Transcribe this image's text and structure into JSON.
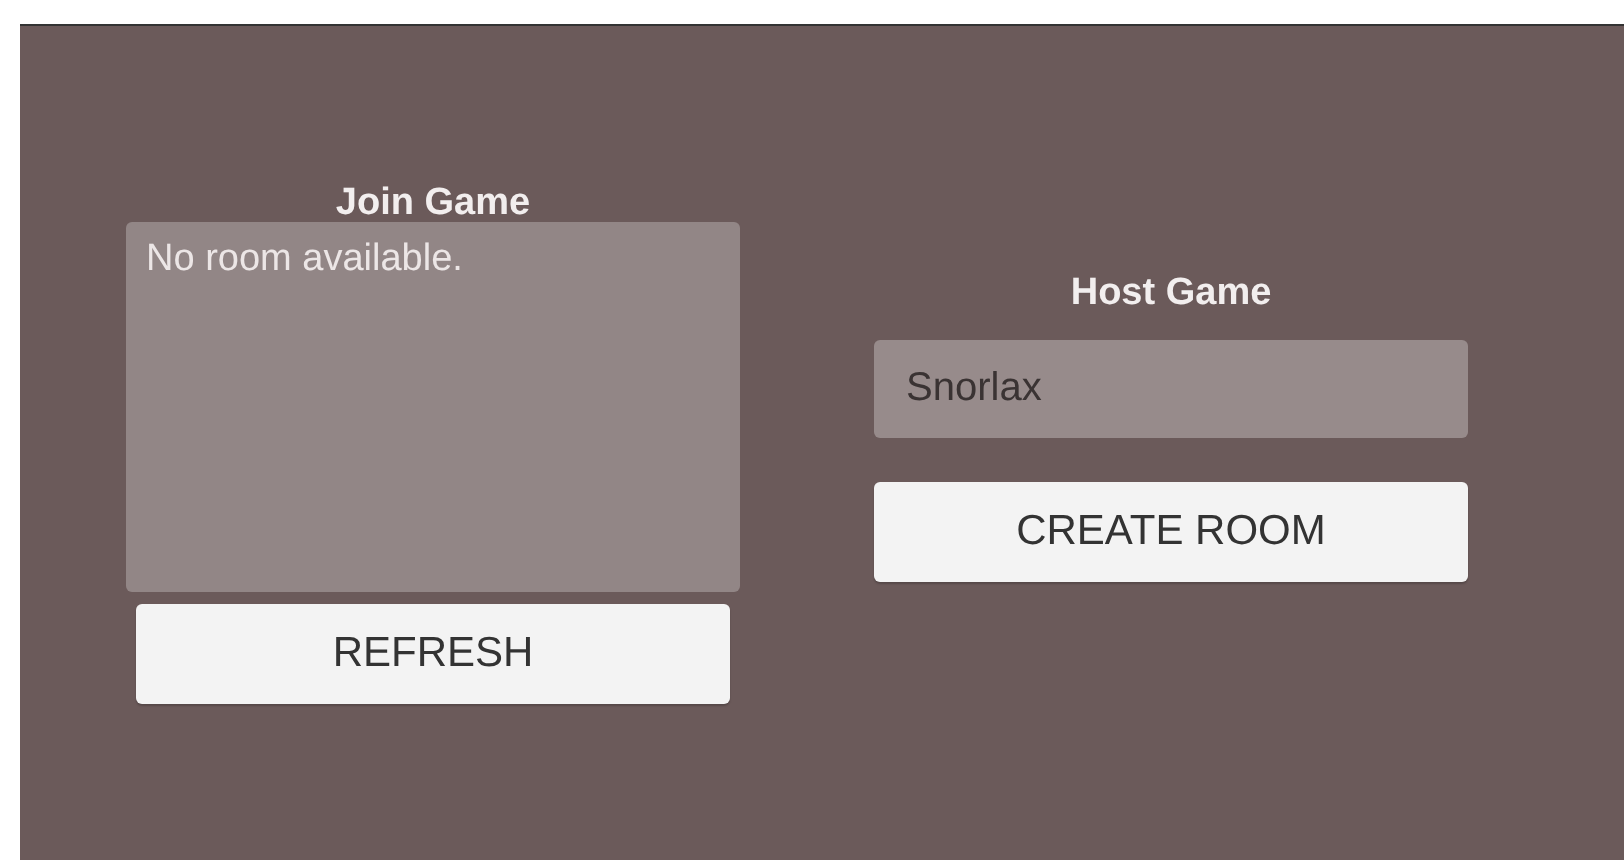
{
  "join_game": {
    "title": "Join Game",
    "room_list": {
      "message": "No room available."
    },
    "refresh_button": "REFRESH"
  },
  "host_game": {
    "title": "Host Game",
    "name_field": {
      "value": "Snorlax"
    },
    "create_button": "CREATE ROOM"
  }
}
